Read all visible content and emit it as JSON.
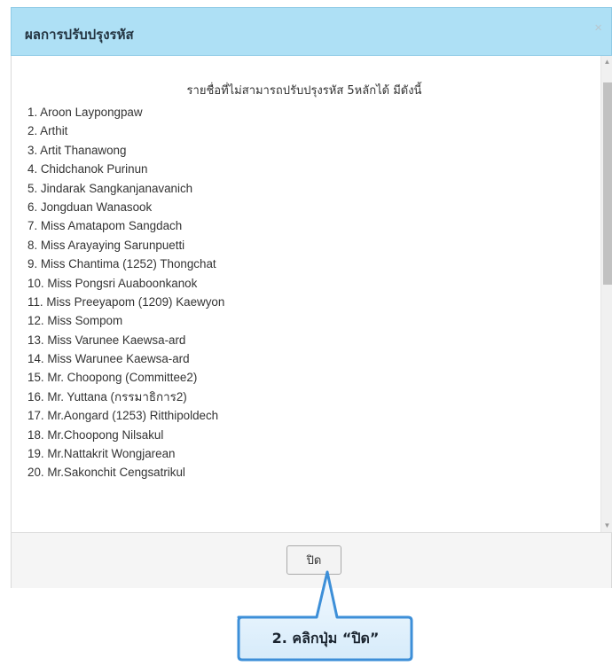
{
  "dialog": {
    "title": "ผลการปรับปรุงรหัส",
    "close_symbol": "×",
    "heading": "รายชื่อที่ไม่สามารถปรับปรุงรหัส 5หลักได้ มีดังนี้",
    "names": [
      "1. Aroon Laypongpaw",
      "2. Arthit",
      "3. Artit Thanawong",
      "4. Chidchanok Purinun",
      "5. Jindarak Sangkanjanavanich",
      "6. Jongduan Wanasook",
      "7. Miss Amatapom Sangdach",
      "8. Miss Arayaying Sarunpuetti",
      "9. Miss Chantima (1252) Thongchat",
      "10. Miss Pongsri Auaboonkanok",
      "11. Miss Preeyapom (1209) Kaewyon",
      "12. Miss Sompom",
      "13. Miss Varunee Kaewsa-ard",
      "14. Miss Warunee Kaewsa-ard",
      "15. Mr. Choopong (Committee2)",
      "16. Mr. Yuttana (กรรมาธิการ2)",
      "17. Mr.Aongard (1253) Ritthipoldech",
      "18. Mr.Choopong Nilsakul",
      "19. Mr.Nattakrit Wongjarean",
      "20. Mr.Sakonchit Cengsatrikul"
    ],
    "close_button_label": "ปิด",
    "scroll_up_symbol": "▲",
    "scroll_down_symbol": "▼"
  },
  "annotation": {
    "text": "2. คลิกปุ่ม “ปิด”",
    "border_color": "#3d8fd8",
    "fill_color": "#e3f1fb"
  },
  "colors": {
    "header_bg": "#aee0f5",
    "footer_bg": "#f5f5f5"
  }
}
